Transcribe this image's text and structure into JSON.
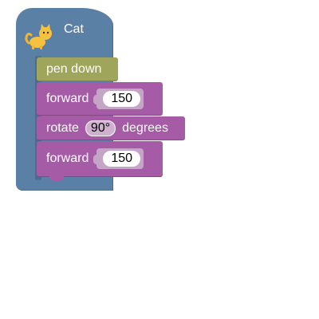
{
  "sprite": {
    "name": "Cat",
    "icon": "cat-icon",
    "color": "#5b80a5"
  },
  "blocks": [
    {
      "type": "pen",
      "label": "pen down",
      "color": "#9fa55b"
    },
    {
      "type": "forward",
      "label": "forward",
      "value": "150",
      "color": "#a55ba5"
    },
    {
      "type": "rotate",
      "label": "rotate",
      "value": "90°",
      "suffix": "degrees",
      "color": "#a55ba5"
    },
    {
      "type": "forward",
      "label": "forward",
      "value": "150",
      "color": "#a55ba5"
    }
  ]
}
